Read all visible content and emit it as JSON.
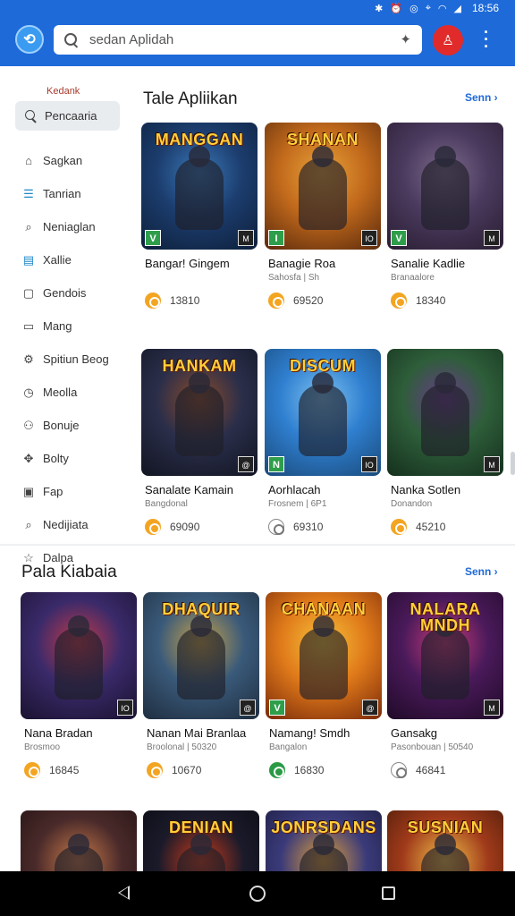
{
  "status_bar": {
    "time": "18:56",
    "icons": [
      "bluetooth-icon",
      "alarm-icon",
      "vibrate-icon",
      "location-icon",
      "wifi-icon",
      "signal-icon"
    ]
  },
  "app_bar": {
    "search_placeholder": "sedan Aplidah",
    "avatar_icon": "user-icon"
  },
  "sidebar": {
    "heading": "Kedank",
    "search_label": "Pencaaria",
    "items": [
      {
        "label": "Sagkan",
        "icon": "house-icon"
      },
      {
        "label": "Tanrian",
        "icon": "list-icon"
      },
      {
        "label": "Neniaglan",
        "icon": "search-icon"
      },
      {
        "label": "Xallie",
        "icon": "book-icon"
      },
      {
        "label": "Gendois",
        "icon": "document-icon"
      },
      {
        "label": "Mang",
        "icon": "tablet-icon"
      },
      {
        "label": "Spitiun Beog",
        "icon": "settings-icon"
      },
      {
        "label": "Meolla",
        "icon": "clock-icon"
      },
      {
        "label": "Bonuje",
        "icon": "people-icon"
      },
      {
        "label": "Bolty",
        "icon": "gamepad-icon"
      },
      {
        "label": "Fap",
        "icon": "lock-icon"
      },
      {
        "label": "Nedijiata",
        "icon": "search-icon"
      },
      {
        "label": "Dalpa",
        "icon": "star-icon"
      }
    ]
  },
  "section1": {
    "title": "Tale Apliikan",
    "see_all": "Senn ›",
    "cards": [
      {
        "name": "Bangar! Gingem",
        "sub": "",
        "rating": "13810",
        "banner": "MANGGAN",
        "badge_l": "V",
        "badge_r": "M",
        "coin": "orange",
        "colors": [
          "#1c3d6e",
          "#3a78b8",
          "#0d1f3a"
        ]
      },
      {
        "name": "Banagie Roa",
        "sub": "Sahosfa | Sh",
        "rating": "69520",
        "banner": "SHANAN",
        "badge_l": "I",
        "badge_r": "IO",
        "coin": "orange",
        "colors": [
          "#c26a1c",
          "#e8a33a",
          "#5b2a0c"
        ]
      },
      {
        "name": "Sanalie Kadlie",
        "sub": "Branaalore",
        "rating": "18340",
        "banner": "",
        "badge_l": "V",
        "badge_r": "M",
        "coin": "orange",
        "colors": [
          "#4a3a5e",
          "#7d6a8a",
          "#2a1e32"
        ]
      },
      {
        "name": "Sanalate Kamain",
        "sub": "Bangdonal",
        "rating": "69090",
        "banner": "HANKAM",
        "badge_l": "",
        "badge_r": "@",
        "coin": "orange",
        "colors": [
          "#2a2e4a",
          "#8a4b2a",
          "#121522"
        ]
      },
      {
        "name": "Aorhlacah",
        "sub": "Frosnem | 6P1",
        "rating": "69310",
        "banner": "DISCUM",
        "badge_l": "N",
        "badge_r": "IO",
        "coin": "outline",
        "colors": [
          "#2f7fd0",
          "#7ec2f0",
          "#1a4a7a"
        ]
      },
      {
        "name": "Nanka Sotlen",
        "sub": "Donandon",
        "rating": "45210",
        "banner": "",
        "badge_l": "",
        "badge_r": "M",
        "coin": "orange",
        "colors": [
          "#2e5e3a",
          "#6a3a8a",
          "#15301d"
        ]
      }
    ]
  },
  "section2": {
    "title": "Pala Kiabaia",
    "see_all": "Senn ›",
    "cards": [
      {
        "name": "Nana Bradan",
        "sub": "Brosmoo",
        "rating": "16845",
        "banner": "",
        "badge_l": "",
        "badge_r": "IO",
        "coin": "orange",
        "colors": [
          "#3a2a6a",
          "#c23a4a",
          "#1a1230"
        ]
      },
      {
        "name": "Nanan Mai Branlaa",
        "sub": "Broolonal | 50320",
        "rating": "10670",
        "banner": "DHAQUIR",
        "badge_l": "",
        "badge_r": "@",
        "coin": "orange",
        "colors": [
          "#3a5a7a",
          "#c8a24a",
          "#1f2e40"
        ]
      },
      {
        "name": "Namang! Smdh",
        "sub": "Bangalon",
        "rating": "16830",
        "banner": "CHANAAN",
        "badge_l": "V",
        "badge_r": "@",
        "coin": "green",
        "colors": [
          "#e07a1a",
          "#f5c23a",
          "#7a2a0a"
        ]
      },
      {
        "name": "Gansakg",
        "sub": "Pasonbouan | 50540",
        "rating": "46841",
        "banner": "NALARA MNDH",
        "badge_l": "",
        "badge_r": "M",
        "coin": "outline",
        "colors": [
          "#4a1a5a",
          "#c83a7a",
          "#200a28"
        ]
      },
      {
        "name": "",
        "sub": "",
        "rating": "",
        "banner": "",
        "badge_l": "",
        "badge_r": "",
        "coin": "",
        "colors": [
          "#4a2a2a",
          "#c87a4a",
          "#201010"
        ]
      },
      {
        "name": "",
        "sub": "",
        "rating": "",
        "banner": "DENIAN",
        "badge_l": "",
        "badge_r": "",
        "coin": "",
        "colors": [
          "#1a1a2a",
          "#c83a1a",
          "#0a0a12"
        ]
      },
      {
        "name": "",
        "sub": "",
        "rating": "",
        "banner": "JONRSDANS",
        "badge_l": "",
        "badge_r": "",
        "coin": "",
        "colors": [
          "#3a3a7a",
          "#e0a03a",
          "#1a1a3a"
        ]
      },
      {
        "name": "",
        "sub": "",
        "rating": "",
        "banner": "SUSNIAN",
        "badge_l": "",
        "badge_r": "",
        "coin": "",
        "colors": [
          "#a03a1a",
          "#f0c04a",
          "#401808"
        ]
      }
    ]
  },
  "nav_bar": {
    "icons": [
      "back-icon",
      "home-icon",
      "recents-icon"
    ]
  }
}
